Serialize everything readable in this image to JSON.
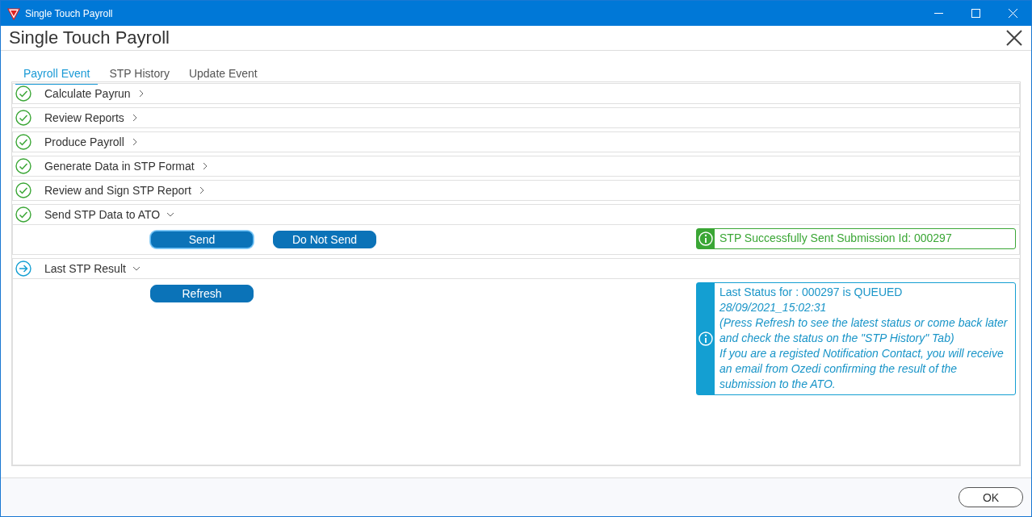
{
  "window": {
    "title": "Single Touch Payroll"
  },
  "dialog": {
    "title": "Single Touch Payroll"
  },
  "tabs": [
    {
      "label": "Payroll Event",
      "selected": true
    },
    {
      "label": "STP History",
      "selected": false
    },
    {
      "label": "Update Event",
      "selected": false
    }
  ],
  "steps": [
    {
      "label": "Calculate Payrun",
      "kind": "done",
      "expanded": false
    },
    {
      "label": "Review Reports",
      "kind": "done",
      "expanded": false
    },
    {
      "label": "Produce Payroll",
      "kind": "done",
      "expanded": false
    },
    {
      "label": "Generate Data in STP Format",
      "kind": "done",
      "expanded": false
    },
    {
      "label": "Review and Sign STP Report",
      "kind": "done",
      "expanded": false
    },
    {
      "label": "Send STP Data to ATO",
      "kind": "done",
      "expanded": true,
      "buttons": [
        {
          "label": "Send",
          "focused": true
        },
        {
          "label": "Do Not Send",
          "focused": false
        }
      ],
      "message": {
        "kind": "success",
        "paragraphs": [
          {
            "text": "STP Successfully Sent Submission Id: 000297",
            "italic": false
          }
        ]
      }
    },
    {
      "label": "Last STP Result",
      "kind": "current",
      "expanded": true,
      "buttons": [
        {
          "label": "Refresh",
          "focused": false
        }
      ],
      "message": {
        "kind": "info",
        "paragraphs": [
          {
            "text": "Last Status for : 000297 is QUEUED",
            "italic": false
          },
          {
            "text": "28/09/2021_15:02:31",
            "italic": true
          },
          {
            "text": "(Press Refresh to see the latest status or come back later and check the status on the \"STP History\" Tab)",
            "italic": true
          },
          {
            "text": "If you are a registed Notification Contact, you will receive an email from Ozedi confirming the result of the submission to the ATO.",
            "italic": true
          }
        ]
      }
    }
  ],
  "footer": {
    "ok_button": "OK"
  }
}
